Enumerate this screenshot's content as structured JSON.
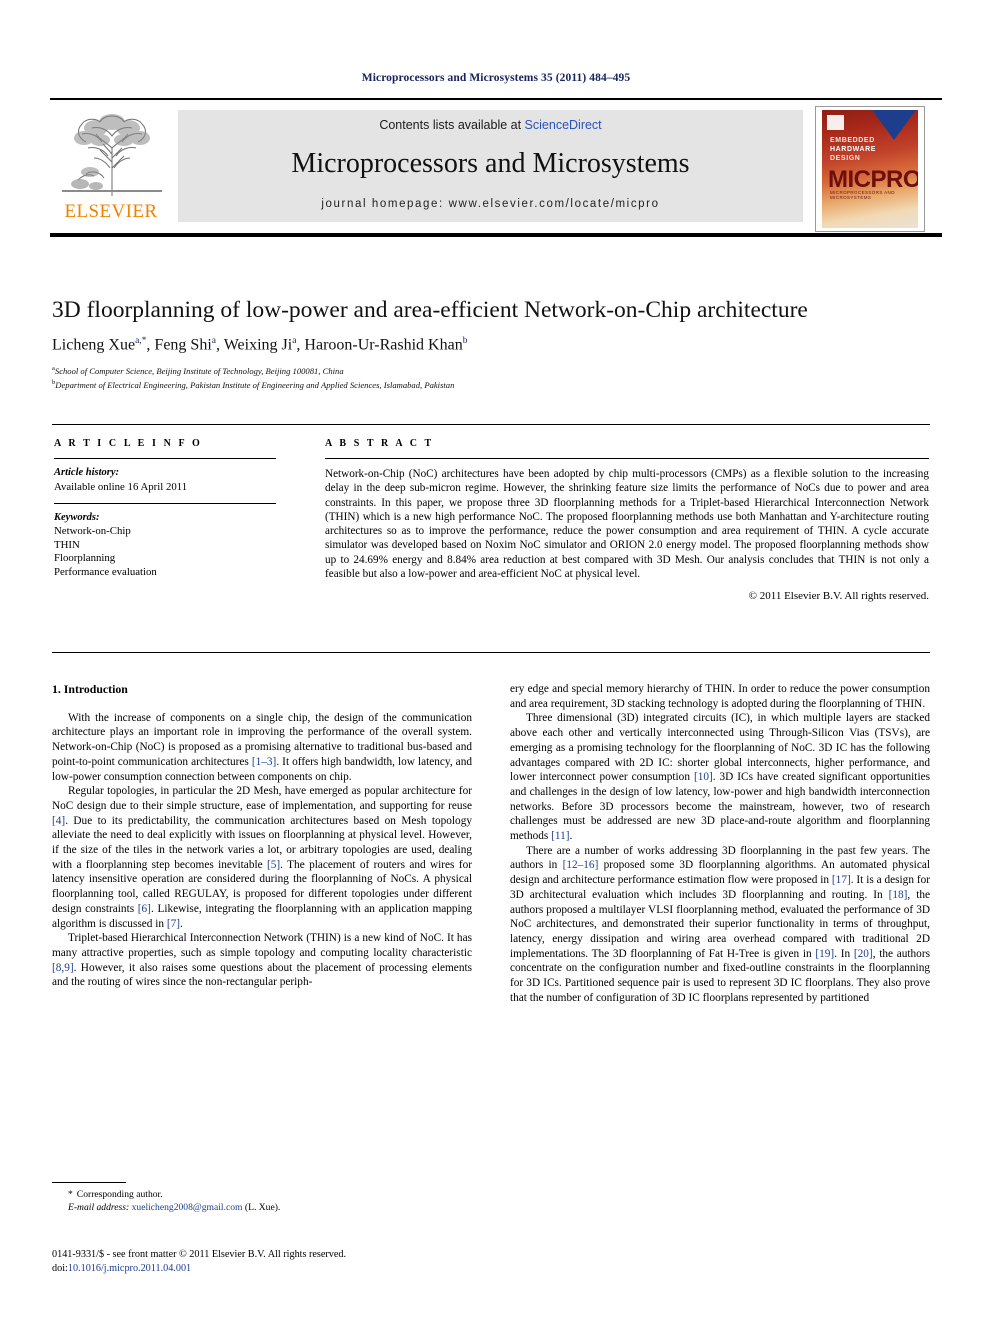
{
  "running_head": "Microprocessors and Microsystems 35 (2011) 484–495",
  "masthead": {
    "publisher_name": "ELSEVIER",
    "contents_prefix": "Contents lists available at ",
    "contents_link": "ScienceDirect",
    "journal_title": "Microprocessors and Microsystems",
    "homepage": "journal homepage: www.elsevier.com/locate/micpro",
    "cover": {
      "kicker_line1": "EMBEDDED",
      "kicker_line2": "HARDWARE",
      "kicker_line3": "DESIGN",
      "wordmark": "MICPRO",
      "subtitle": "MICROPROCESSORS AND MICROSYSTEMS"
    }
  },
  "article": {
    "title": "3D floorplanning of low-power and area-efficient Network-on-Chip architecture",
    "authors_html": "Licheng Xue, Feng Shi, Weixing Ji, Haroon-Ur-Rashid Khan",
    "author_list": [
      {
        "name": "Licheng Xue",
        "marks": "a,*"
      },
      {
        "name": "Feng Shi",
        "marks": "a"
      },
      {
        "name": "Weixing Ji",
        "marks": "a"
      },
      {
        "name": "Haroon-Ur-Rashid Khan",
        "marks": "b"
      }
    ],
    "affiliations": [
      {
        "mark": "a",
        "text": "School of Computer Science, Beijing Institute of Technology, Beijing 100081, China"
      },
      {
        "mark": "b",
        "text": "Department of Electrical Engineering, Pakistan Institute of Engineering and Applied Sciences, Islamabad, Pakistan"
      }
    ]
  },
  "article_info": {
    "heading": "A R T I C L E    I N F O",
    "history_label": "Article history:",
    "history_value": "Available online 16 April 2011",
    "keywords_label": "Keywords:",
    "keywords": [
      "Network-on-Chip",
      "THIN",
      "Floorplanning",
      "Performance evaluation"
    ]
  },
  "abstract": {
    "heading": "A B S T R A C T",
    "body": "Network-on-Chip (NoC) architectures have been adopted by chip multi-processors (CMPs) as a flexible solution to the increasing delay in the deep sub-micron regime. However, the shrinking feature size limits the performance of NoCs due to power and area constraints. In this paper, we propose three 3D floorplanning methods for a Triplet-based Hierarchical Interconnection Network (THIN) which is a new high performance NoC. The proposed floorplanning methods use both Manhattan and Y-architecture routing architectures so as to improve the performance, reduce the power consumption and area requirement of THIN. A cycle accurate simulator was developed based on Noxim NoC simulator and ORION 2.0 energy model. The proposed floorplanning methods show up to 24.69% energy and 8.84% area reduction at best compared with 3D Mesh. Our analysis concludes that THIN is not only a feasible but also a low-power and area-efficient NoC at physical level.",
    "copyright": "© 2011 Elsevier B.V. All rights reserved."
  },
  "body": {
    "section_heading": "1. Introduction",
    "left_paragraphs": [
      "With the increase of components on a single chip, the design of the communication architecture plays an important role in improving the performance of the overall system. Network-on-Chip (NoC) is proposed as a promising alternative to traditional bus-based and point-to-point communication architectures [1–3]. It offers high bandwidth, low latency, and low-power consumption connection between components on chip.",
      "Regular topologies, in particular the 2D Mesh, have emerged as popular architecture for NoC design due to their simple structure, ease of implementation, and supporting for reuse [4]. Due to its predictability, the communication architectures based on Mesh topology alleviate the need to deal explicitly with issues on floorplanning at physical level. However, if the size of the tiles in the network varies a lot, or arbitrary topologies are used, dealing with a floorplanning step becomes inevitable [5]. The placement of routers and wires for latency insensitive operation are considered during the floorplanning of NoCs. A physical floorplanning tool, called REGULAY, is proposed for different topologies under different design constraints [6]. Likewise, integrating the floorplanning with an application mapping algorithm is discussed in [7].",
      "Triplet-based Hierarchical Interconnection Network (THIN) is a new kind of NoC. It has many attractive properties, such as simple topology and computing locality characteristic [8,9]. However, it also raises some questions about the placement of processing elements and the routing of wires since the non-rectangular periph-"
    ],
    "right_paragraphs": [
      "ery edge and special memory hierarchy of THIN. In order to reduce the power consumption and area requirement, 3D stacking technology is adopted during the floorplanning of THIN.",
      "Three dimensional (3D) integrated circuits (IC), in which multiple layers are stacked above each other and vertically interconnected using Through-Silicon Vias (TSVs), are emerging as a promising technology for the floorplanning of NoC. 3D IC has the following advantages compared with 2D IC: shorter global interconnects, higher performance, and lower interconnect power consumption [10]. 3D ICs have created significant opportunities and challenges in the design of low latency, low-power and high bandwidth interconnection networks. Before 3D processors become the mainstream, however, two of research challenges must be addressed are new 3D place-and-route algorithm and floorplanning methods [11].",
      "There are a number of works addressing 3D floorplanning in the past few years. The authors in [12–16] proposed some 3D floorplanning algorithms. An automated physical design and architecture performance estimation flow were proposed in [17]. It is a design for 3D architectural evaluation which includes 3D floorplanning and routing. In [18], the authors proposed a multilayer VLSI floorplanning method, evaluated the performance of 3D NoC architectures, and demonstrated their superior functionality in terms of throughput, latency, energy dissipation and wiring area overhead compared with traditional 2D implementations. The 3D floorplanning of Fat H-Tree is given in [19]. In [20], the authors concentrate on the configuration number and fixed-outline constraints in the floorplanning for 3D ICs. Partitioned sequence pair is used to represent 3D IC floorplans. They also prove that the number of configuration of 3D IC floorplans represented by partitioned"
    ]
  },
  "footnote": {
    "corresponding": "Corresponding author.",
    "email_label": "E-mail address:",
    "email": "xuelicheng2008@gmail.com",
    "email_suffix": "(L. Xue)."
  },
  "footer": {
    "issn_line": "0141-9331/$ - see front matter © 2011 Elsevier B.V. All rights reserved.",
    "doi_label": "doi:",
    "doi_value": "10.1016/j.micpro.2011.04.001"
  },
  "colors": {
    "link_blue": "#1d3d8f",
    "sciencedirect_blue": "#2a52b8",
    "elsevier_orange": "#ef8200",
    "running_head_navy": "#17215e",
    "grey_box": "#e4e4e4"
  }
}
